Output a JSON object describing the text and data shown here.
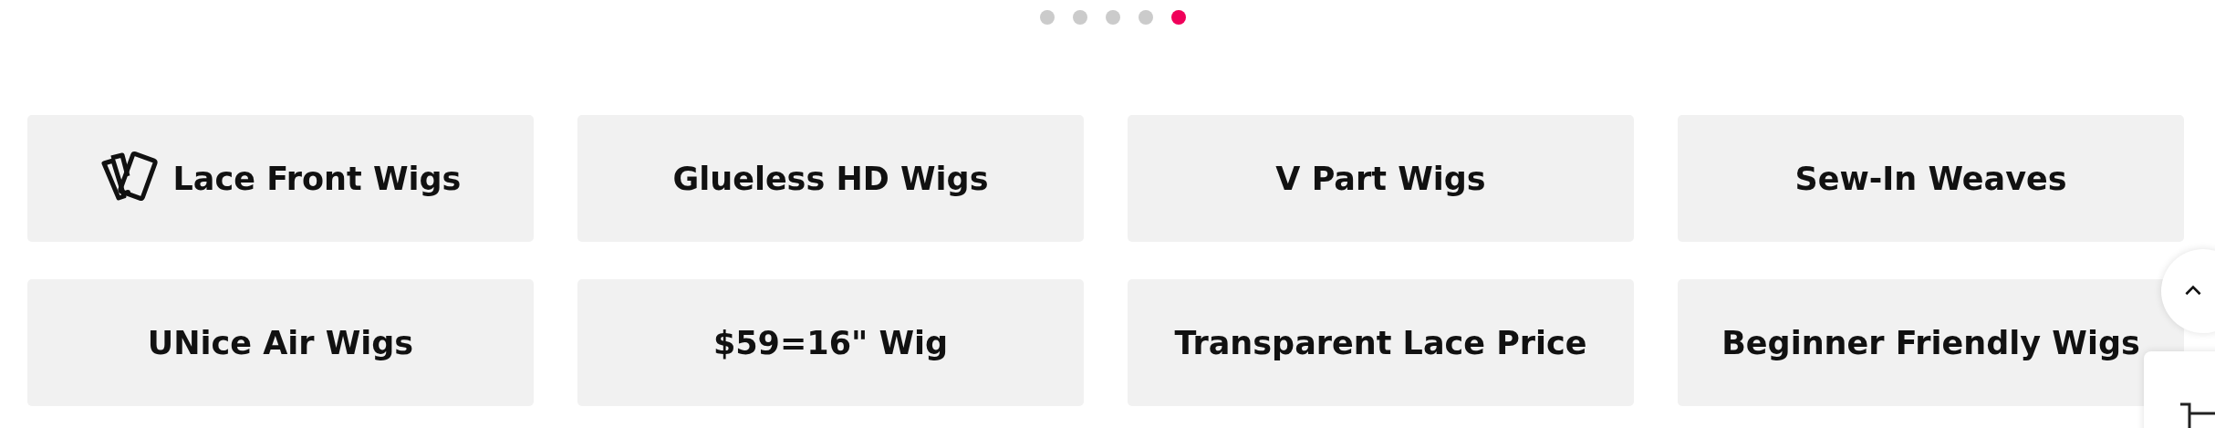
{
  "carousel_dots": [
    {
      "selected": false
    },
    {
      "selected": false
    },
    {
      "selected": false
    },
    {
      "selected": false
    },
    {
      "selected": true
    }
  ],
  "categories": [
    {
      "label": "Lace Front Wigs",
      "kind": "with-icon"
    },
    {
      "label": "Glueless HD Wigs",
      "kind": "plain"
    },
    {
      "label": "V Part Wigs",
      "kind": "plain"
    },
    {
      "label": "Sew-In Weaves",
      "kind": "plain"
    },
    {
      "label": "UNice Air Wigs",
      "kind": "plain"
    },
    {
      "label": "$59=16\" Wig",
      "kind": "plain"
    },
    {
      "label": "Transparent Lace Price",
      "kind": "plain"
    },
    {
      "label": "Beginner Friendly Wigs",
      "kind": "plain"
    }
  ]
}
